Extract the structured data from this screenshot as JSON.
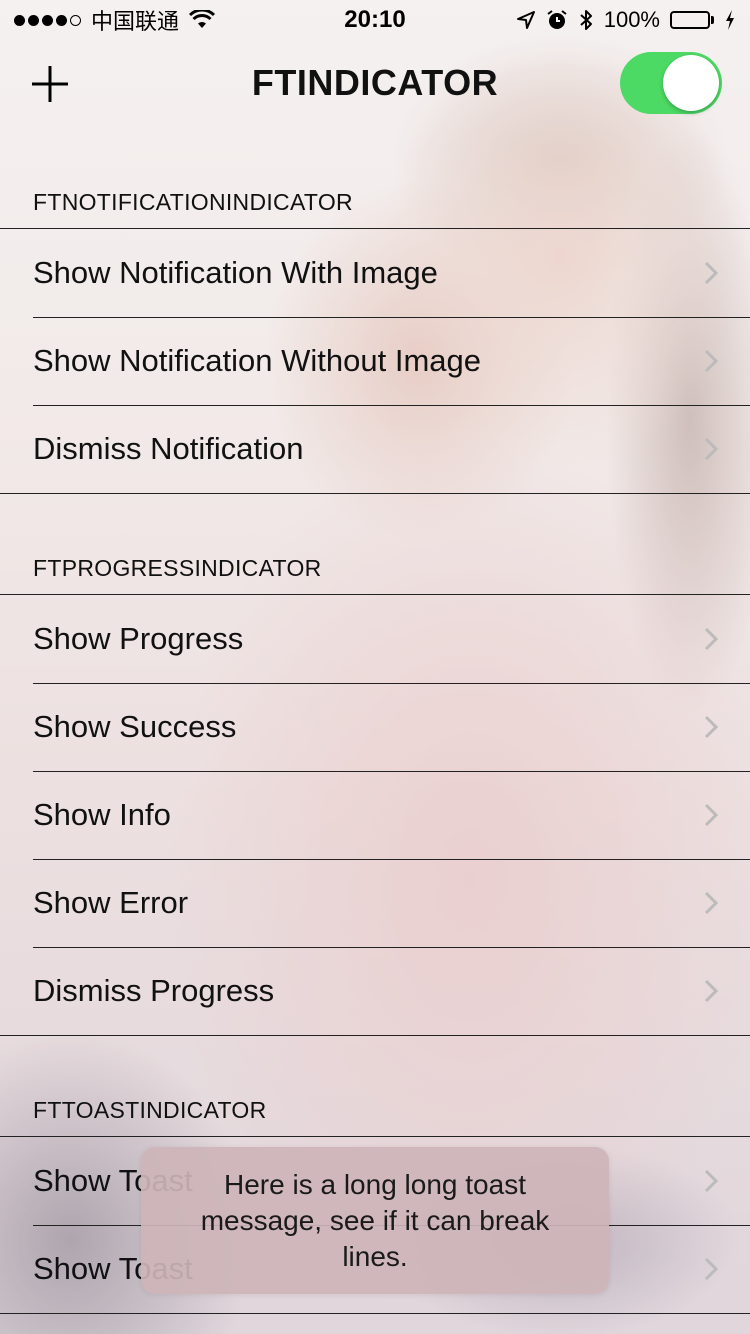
{
  "status_bar": {
    "carrier": "中国联通",
    "time": "20:10",
    "battery_percent": "100%",
    "battery_color": "#4cd964",
    "icons": [
      "signal-dots-icon",
      "wifi-icon",
      "location-arrow-icon",
      "alarm-icon",
      "bluetooth-icon",
      "battery-icon",
      "charging-bolt-icon"
    ]
  },
  "nav": {
    "title": "FTINDICATOR",
    "add_icon": "plus-icon",
    "toggle_on": true,
    "toggle_color": "#4cd964"
  },
  "sections": [
    {
      "header": "FTNOTIFICATIONINDICATOR",
      "items": [
        {
          "label": "Show Notification With Image"
        },
        {
          "label": "Show Notification Without Image"
        },
        {
          "label": "Dismiss Notification"
        }
      ]
    },
    {
      "header": "FTPROGRESSINDICATOR",
      "items": [
        {
          "label": "Show Progress"
        },
        {
          "label": "Show Success"
        },
        {
          "label": "Show Info"
        },
        {
          "label": "Show Error"
        },
        {
          "label": "Dismiss Progress"
        }
      ]
    },
    {
      "header": "FTTOASTINDICATOR",
      "items": [
        {
          "label": "Show Toast"
        },
        {
          "label": "Show Toast"
        }
      ]
    }
  ],
  "toast": {
    "message": "Here is a long long toast message, see if it can break lines."
  }
}
